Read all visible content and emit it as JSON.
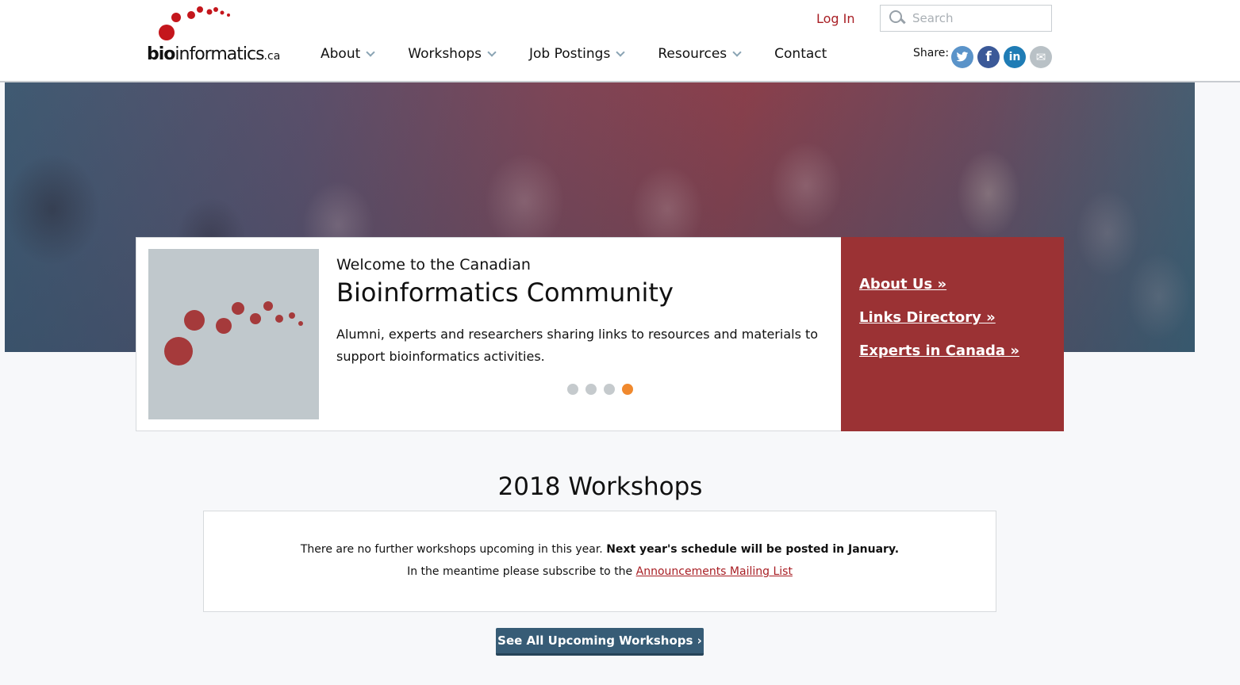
{
  "header": {
    "logo": {
      "text_bold": "bio",
      "text_main": "informatics",
      "text_suffix": ".ca",
      "dot_color": "#c4161c"
    },
    "nav": [
      {
        "label": "About",
        "has_dropdown": true
      },
      {
        "label": "Workshops",
        "has_dropdown": true
      },
      {
        "label": "Job Postings",
        "has_dropdown": true
      },
      {
        "label": "Resources",
        "has_dropdown": true
      },
      {
        "label": "Contact",
        "has_dropdown": false
      }
    ],
    "login_label": "Log In",
    "search": {
      "placeholder": "Search",
      "value": ""
    },
    "share": {
      "label": "Share:",
      "icons": [
        {
          "name": "twitter-icon",
          "glyph": "🐦",
          "color": "#5a93c9"
        },
        {
          "name": "facebook-icon",
          "glyph": "f",
          "color": "#3b5998"
        },
        {
          "name": "linkedin-icon",
          "glyph": "in",
          "color": "#1f7cb5"
        },
        {
          "name": "email-icon",
          "glyph": "✉",
          "color": "#b9c1c6"
        }
      ]
    }
  },
  "welcome": {
    "subtitle": "Welcome to the Canadian",
    "title": "Bioinformatics Community",
    "description": "Alumni, experts and researchers sharing links to resources and materials to support bioinformatics activities.",
    "slides": {
      "count": 4,
      "active_index": 3
    }
  },
  "quick_links": [
    {
      "label": "About Us »"
    },
    {
      "label": "Links Directory »"
    },
    {
      "label": "Experts in Canada »"
    }
  ],
  "workshops": {
    "heading": "2018 Workshops",
    "line1_normal": "There are no further workshops upcoming in this year. ",
    "line1_bold": "Next year's schedule will be posted in January.",
    "line2_prefix": "In the meantime please subscribe to the ",
    "line2_link": "Announcements Mailing List",
    "button_label": "See All Upcoming Workshops ›"
  },
  "colors": {
    "brand_red": "#a81e24",
    "panel_red": "#9b3234",
    "button_blue": "#375c76",
    "active_dot": "#f0892e"
  }
}
